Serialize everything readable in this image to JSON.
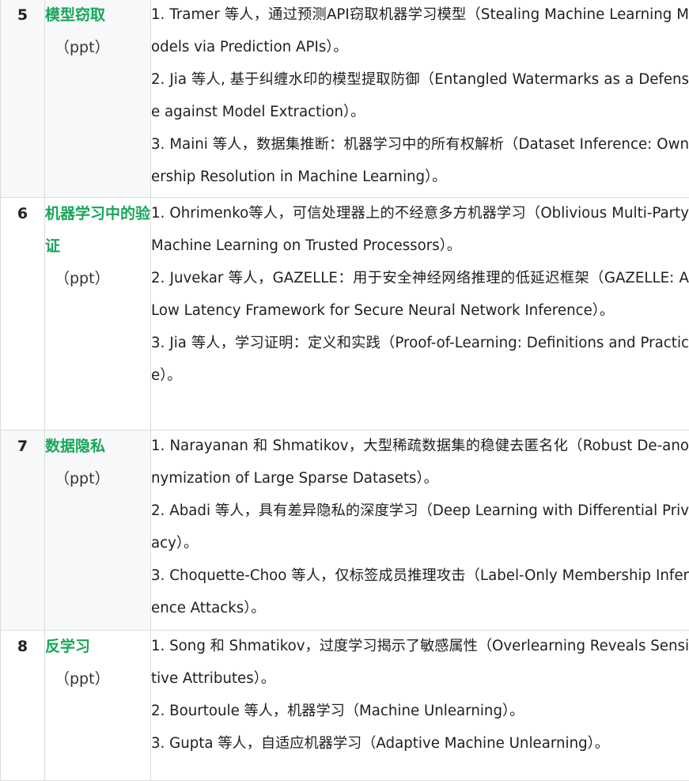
{
  "rows": [
    {
      "number": "5",
      "topic": "模型窃取",
      "tag": "（ppt）",
      "papers": [
        "1. Tramer 等人，通过预测API窃取机器学习模型（Stealing Machine Learning Models via Prediction APIs）。",
        "2. Jia 等人, 基于纠缠水印的模型提取防御（Entangled Watermarks as a Defense against Model Extraction）。",
        "3. Maini 等人，数据集推断：机器学习中的所有权解析（Dataset Inference: Ownership Resolution in Machine Learning）。"
      ]
    },
    {
      "number": "6",
      "topic": "机器学习中的验证",
      "tag": "（ppt）",
      "papers": [
        "1. Ohrimenko等人，可信处理器上的不经意多方机器学习（Oblivious Multi-Party Machine Learning on Trusted Processors）。",
        "2. Juvekar 等人，GAZELLE：用于安全神经网络推理的低延迟框架（GAZELLE: A Low Latency Framework for Secure Neural Network Inference）。",
        "3. Jia 等人，学习证明：定义和实践（Proof-of-Learning: Definitions and Practice）。"
      ]
    },
    {
      "number": "7",
      "topic": "数据隐私",
      "tag": "（ppt）",
      "papers": [
        "1. Narayanan 和 Shmatikov，大型稀疏数据集的稳健去匿名化（Robust De-anonymization of Large Sparse Datasets）。",
        "2. Abadi 等人，具有差异隐私的深度学习（Deep Learning with Differential Privacy）。",
        "3. Choquette-Choo 等人，仅标签成员推理攻击（Label-Only Membership Inference Attacks）。"
      ]
    },
    {
      "number": "8",
      "topic": "反学习",
      "tag": "（ppt）",
      "papers": [
        "1. Song 和 Shmatikov，过度学习揭示了敏感属性（Overlearning Reveals Sensitive Attributes）。",
        "2. Bourtoule 等人，机器学习（Machine Unlearning）。",
        "3. Gupta 等人，自适应机器学习（Adaptive Machine Unlearning）。"
      ]
    }
  ],
  "colors": {
    "topic": "#18a75a",
    "border": "#dcdcdc",
    "shade": "#f7f8fa"
  }
}
